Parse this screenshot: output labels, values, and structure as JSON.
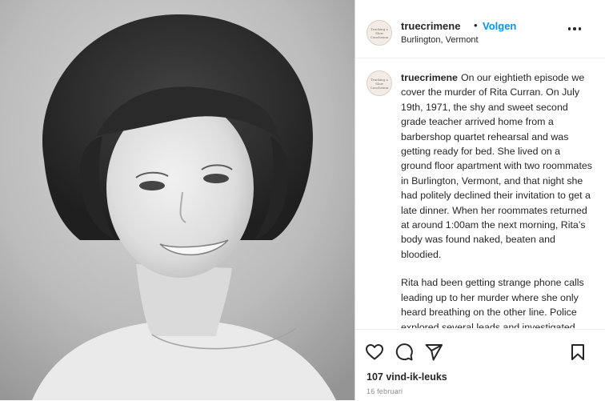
{
  "post": {
    "username": "truecrimene",
    "separator": "•",
    "follow_label": "Volgen",
    "location": "Burlington, Vermont",
    "avatar_text": "Tracking a Slow Conclusion"
  },
  "caption": {
    "username": "truecrimene",
    "paragraph_1": "On our eightieth episode we cover the murder of Rita Curran. On July 19th, 1971, the shy and sweet second grade teacher arrived home from a barbershop quartet rehearsal and was getting ready for bed. She lived on a ground floor apartment with two roommates in Burlington, Vermont, and that night she had politely declined their invitation to get a late dinner. When her roommates returned at around 1:00am the next morning, Rita’s body was found naked, beaten and bloodied.",
    "paragraph_2": "Rita had been getting strange phone calls leading up to her murder where she only heard breathing on the other line. Police explored several leads and investigated similar strange phone"
  },
  "actions": {
    "like_icon": "heart-icon",
    "comment_icon": "comment-icon",
    "share_icon": "send-icon",
    "save_icon": "bookmark-icon"
  },
  "stats": {
    "likes": "107 vind-ik-leuks",
    "date": "16 februari"
  },
  "photo": {
    "description_icon": "portrait-photo"
  }
}
